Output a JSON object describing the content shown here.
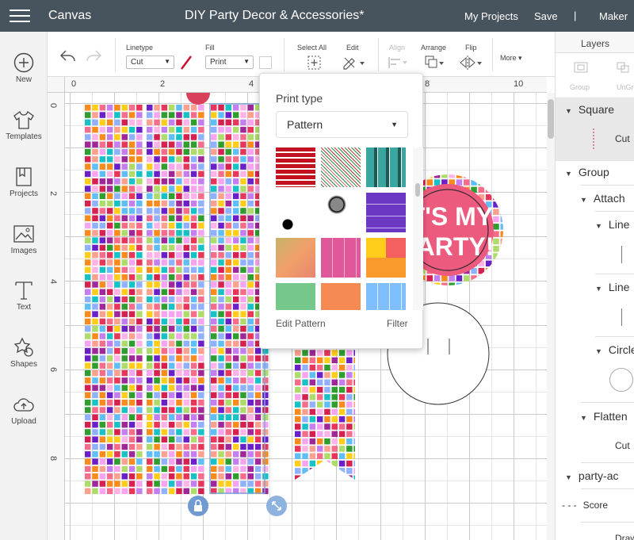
{
  "topbar": {
    "menu_icon": "hamburger-icon",
    "app": "Canvas",
    "project_title": "DIY Party Decor & Accessories*",
    "my_projects": "My Projects",
    "save": "Save",
    "separator": "|",
    "machine": "Maker"
  },
  "sidebar": {
    "items": [
      {
        "label": "New",
        "icon": "plus-circle-icon"
      },
      {
        "label": "Templates",
        "icon": "tshirt-icon"
      },
      {
        "label": "Projects",
        "icon": "projects-icon"
      },
      {
        "label": "Images",
        "icon": "image-icon"
      },
      {
        "label": "Text",
        "icon": "text-icon"
      },
      {
        "label": "Shapes",
        "icon": "shapes-icon"
      },
      {
        "label": "Upload",
        "icon": "cloud-upload-icon"
      }
    ]
  },
  "toolbar": {
    "linetype_label": "Linetype",
    "linetype_value": "Cut",
    "linetype_color": "#c8102e",
    "fill_label": "Fill",
    "fill_value": "Print",
    "select_all": "Select All",
    "edit": "Edit",
    "align": "Align",
    "arrange": "Arrange",
    "flip": "Flip",
    "more": "More ▾"
  },
  "rulers": {
    "top": [
      "0",
      "2",
      "4",
      "8",
      "10"
    ],
    "left": [
      "0",
      "2",
      "4",
      "6",
      "8"
    ]
  },
  "canvas": {
    "mosaic_colors": [
      "#d6204f",
      "#f56d8a",
      "#8fb1ff",
      "#c57ef0",
      "#6a1fc9",
      "#a0279a",
      "#fca08f",
      "#f98a1c",
      "#ffcd1a",
      "#2f9e2f",
      "#17c2c6",
      "#aedc6a",
      "#f6a3f0",
      "#5fbef5",
      "#e8365a",
      "#ffb3e6"
    ],
    "badge_text": [
      "IT'S MY",
      "PARTY!"
    ],
    "badge_color": "#ec5b7e"
  },
  "popup": {
    "title": "Print type",
    "dropdown_value": "Pattern",
    "tiles": [
      "red-stripes",
      "diagonal-stripes",
      "teal-plaid",
      "black-white-script",
      "floral-lace",
      "purple-stitched",
      "gradient-orange",
      "pink-stitched",
      "color-block",
      "green-confetti",
      "orange-solid",
      "blue-stitched"
    ],
    "edit_pattern": "Edit Pattern",
    "filter": "Filter"
  },
  "layers": {
    "title": "Layers",
    "group": "Group",
    "ungroup": "UnGroup",
    "items": [
      {
        "label": "Square"
      },
      {
        "label": "Cut"
      },
      {
        "label": "Group"
      },
      {
        "label": "Attach"
      },
      {
        "label": "Line"
      },
      {
        "label": "Line"
      },
      {
        "label": "Circle"
      },
      {
        "label": "Flatten"
      },
      {
        "label": "Cut"
      },
      {
        "label": "party-ac"
      },
      {
        "label": "Score"
      },
      {
        "label": "Draw"
      }
    ]
  }
}
